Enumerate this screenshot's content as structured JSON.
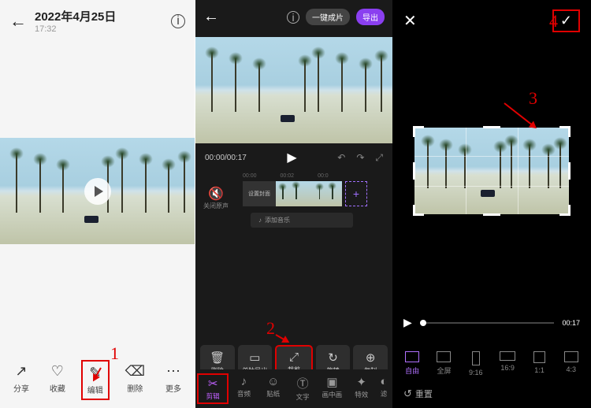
{
  "panel1": {
    "date": "2022年4月25日",
    "time": "17:32",
    "bottom": [
      {
        "icon": "↗",
        "label": "分享"
      },
      {
        "icon": "♡",
        "label": "收藏"
      },
      {
        "icon": "✎",
        "label": "编辑"
      },
      {
        "icon": "⌫",
        "label": "删除"
      },
      {
        "icon": "⋯",
        "label": "更多"
      }
    ]
  },
  "panel2": {
    "pill1": "一键成片",
    "pill2": "导出",
    "time": "00:00/00:17",
    "ticks": [
      "00:00",
      "00:02",
      "00:0"
    ],
    "cover": "设置封面",
    "mute": "关闭原声",
    "music": "添加音乐",
    "tools": [
      {
        "icon": "🗑",
        "label": "删除"
      },
      {
        "icon": "▭",
        "label": "单独导出"
      },
      {
        "icon": "⤢",
        "label": "裁剪"
      },
      {
        "icon": "↻",
        "label": "旋转"
      },
      {
        "icon": "⊕",
        "label": "复制"
      }
    ],
    "tabs": [
      {
        "icon": "✂",
        "label": "剪辑",
        "active": true
      },
      {
        "icon": "♪",
        "label": "音频"
      },
      {
        "icon": "☺",
        "label": "贴纸"
      },
      {
        "icon": "Ⓣ",
        "label": "文字"
      },
      {
        "icon": "▣",
        "label": "画中画"
      },
      {
        "icon": "✦",
        "label": "特效"
      },
      {
        "icon": "◐",
        "label": "滤"
      }
    ]
  },
  "panel3": {
    "duration": "00:17",
    "ratios": [
      {
        "label": "自由",
        "cls": "r-free",
        "active": true
      },
      {
        "label": "全屏",
        "cls": "r-full"
      },
      {
        "label": "9:16",
        "cls": "r-916"
      },
      {
        "label": "16:9",
        "cls": "r-169"
      },
      {
        "label": "1:1",
        "cls": "r-11"
      },
      {
        "label": "4:3",
        "cls": "r-43"
      }
    ],
    "reset": "重置"
  },
  "annot": {
    "n1": "1",
    "n2": "2",
    "n3": "3",
    "n4": "4"
  }
}
